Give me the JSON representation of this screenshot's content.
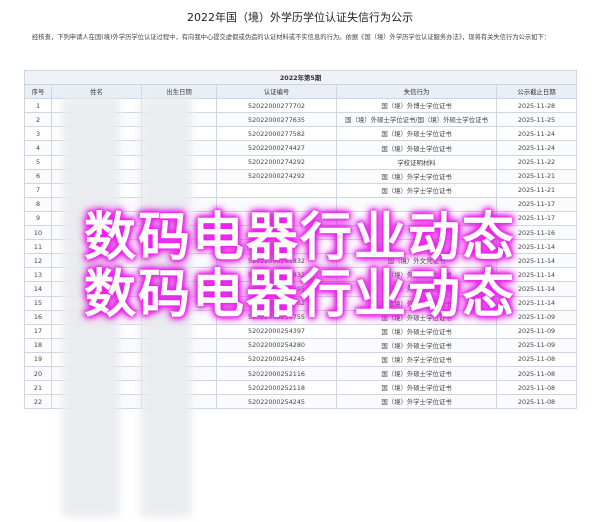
{
  "page": {
    "title": "2022年国（境）外学历学位认证失信行为公示",
    "intro": "经核查，下列申请人在国(境)外学历学位认证过程中，有向我中心提交虚假或伪造的认证材料或不实信息的行为。依据《国（境）外学历学位认证服务办法》，现将有关失信行为公示如下："
  },
  "table": {
    "caption": "2022年第5期",
    "headers": [
      "序号",
      "姓名",
      "出生日期",
      "认证编号",
      "失信行为",
      "公示截止日期"
    ],
    "rows": [
      {
        "no": "1",
        "cert": "52022000277702",
        "act": "国（境）外博士学位证书",
        "end": "2025-11-28"
      },
      {
        "no": "2",
        "cert": "52022000277635",
        "act": "国（境）外硕士学位证书/国（境）外硕士学位证书",
        "end": "2025-11-25"
      },
      {
        "no": "3",
        "cert": "52022000277582",
        "act": "国（境）外硕士学位证书",
        "end": "2025-11-24"
      },
      {
        "no": "4",
        "cert": "52022000274427",
        "act": "国（境）外硕士学位证书",
        "end": "2025-11-24"
      },
      {
        "no": "5",
        "cert": "52022000274292",
        "act": "学校证明材料",
        "end": "2025-11-22"
      },
      {
        "no": "6",
        "cert": "52022000274292",
        "act": "国（境）外学士学位证书",
        "end": "2025-11-21"
      },
      {
        "no": "7",
        "cert": "",
        "act": "国（境）外学士学位证书",
        "end": "2025-11-21"
      },
      {
        "no": "8",
        "cert": "",
        "act": "",
        "end": "2025-11-17"
      },
      {
        "no": "9",
        "cert": "",
        "act": "",
        "end": "2025-11-17"
      },
      {
        "no": "10",
        "cert": "",
        "act": "",
        "end": "2025-11-16"
      },
      {
        "no": "11",
        "cert": "",
        "act": "",
        "end": "2025-11-14"
      },
      {
        "no": "12",
        "cert": "52022000265832",
        "act": "国（境）外文凭证书",
        "end": "2025-11-14"
      },
      {
        "no": "13",
        "cert": "52022000256832",
        "act": "国（境）外硕士学位证书",
        "end": "2025-11-14"
      },
      {
        "no": "14",
        "cert": "52022000256695",
        "act": "国（境）外硕士学位证书",
        "end": "2025-11-14"
      },
      {
        "no": "15",
        "cert": "52022000256562",
        "act": "国（境）外硕士学位证书",
        "end": "2025-11-14"
      },
      {
        "no": "16",
        "cert": "52022000254755",
        "act": "国（境）外硕士学位证书",
        "end": "2025-11-09"
      },
      {
        "no": "17",
        "cert": "52022000254397",
        "act": "国（境）外硕士学位证书",
        "end": "2025-11-09"
      },
      {
        "no": "18",
        "cert": "52022000254280",
        "act": "国（境）外硕士学位证书",
        "end": "2025-11-09"
      },
      {
        "no": "19",
        "cert": "52022000254245",
        "act": "国（境）外学士学位证书",
        "end": "2025-11-08"
      },
      {
        "no": "20",
        "cert": "52022000252116",
        "act": "国（境）外硕士学位证书",
        "end": "2025-11-08"
      },
      {
        "no": "21",
        "cert": "52022000252118",
        "act": "国（境）外硕士学位证书",
        "end": "2025-11-08"
      },
      {
        "no": "22",
        "cert": "52022000254245",
        "act": "国（境）外学士学位证书",
        "end": "2025-11-08"
      }
    ]
  },
  "overlay": {
    "line1": "数码电器行业动态",
    "line2": "数码电器行业动态"
  },
  "colors": {
    "overlay_glow": "#ee22ee",
    "table_border": "#cfd6e2",
    "header_bg": "#e9eef7"
  }
}
